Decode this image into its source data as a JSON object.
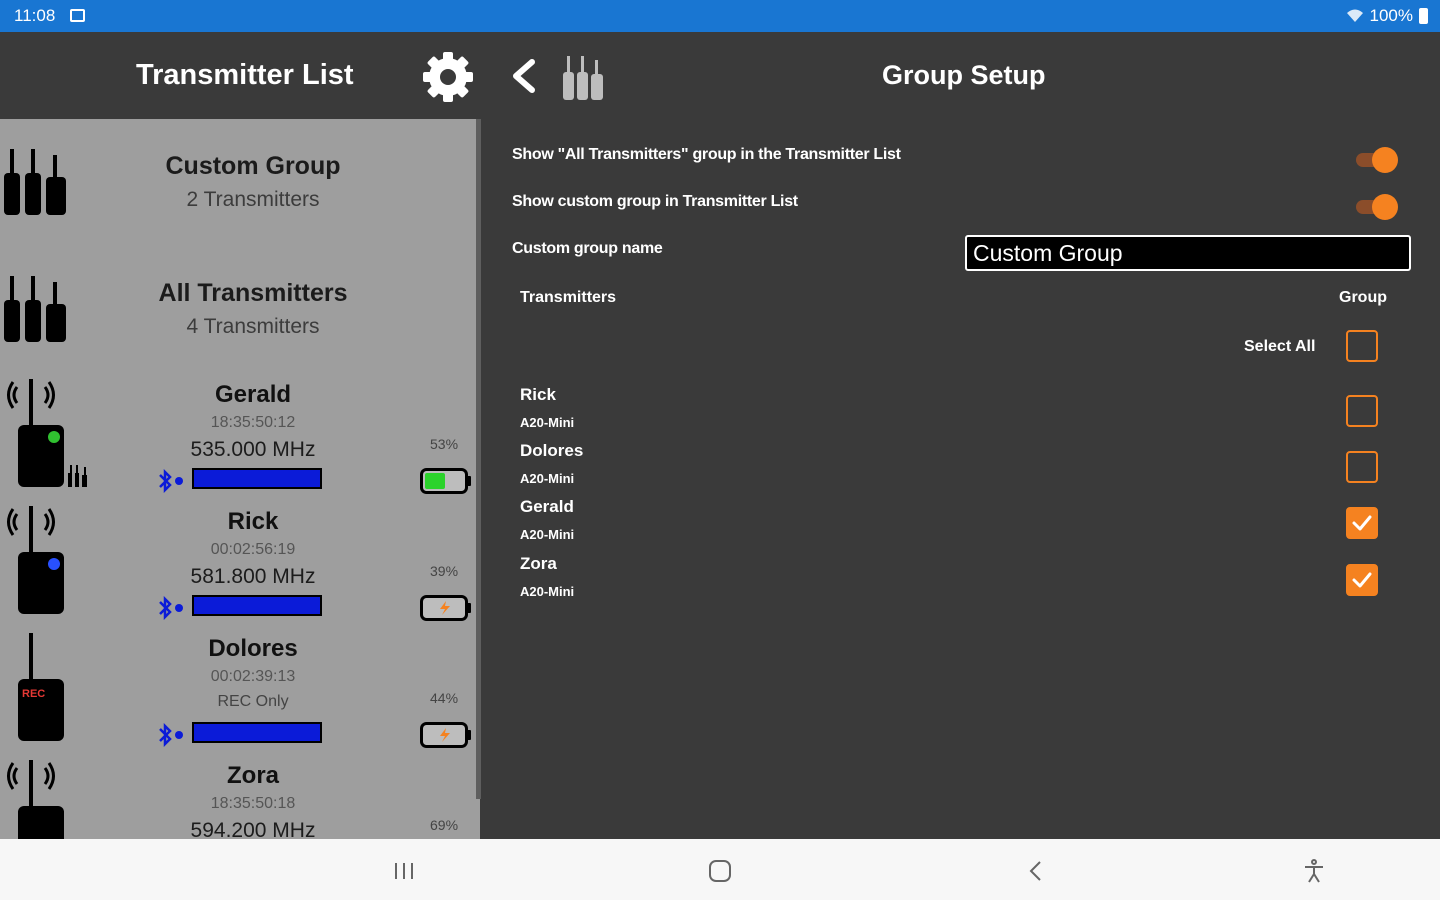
{
  "status_bar": {
    "time": "11:08",
    "battery": "100%"
  },
  "header": {
    "left_title": "Transmitter List",
    "right_title": "Group Setup"
  },
  "transmitter_list": {
    "groups": [
      {
        "name": "Custom Group",
        "count": "2 Transmitters"
      },
      {
        "name": "All Transmitters",
        "count": "4 Transmitters"
      }
    ],
    "transmitters": [
      {
        "name": "Gerald",
        "time": "18:35:50:12",
        "freq": "535.000 MHz",
        "battery_pct": "53%",
        "status_led": "green"
      },
      {
        "name": "Rick",
        "time": "00:02:56:19",
        "freq": "581.800 MHz",
        "battery_pct": "39%",
        "status_led": "blue"
      },
      {
        "name": "Dolores",
        "time": "00:02:39:13",
        "mode": "REC Only",
        "battery_pct": "44%",
        "rec_label": "REC"
      },
      {
        "name": "Zora",
        "time": "18:35:50:18",
        "freq": "594.200 MHz",
        "battery_pct": "69%"
      }
    ]
  },
  "group_setup": {
    "show_all_label": "Show \"All Transmitters\" group in the Transmitter List",
    "show_all_on": true,
    "show_custom_label": "Show custom group in Transmitter List",
    "show_custom_on": true,
    "custom_name_label": "Custom group name",
    "custom_name_value": "Custom Group",
    "col_transmitters": "Transmitters",
    "col_group": "Group",
    "select_all_label": "Select All",
    "items": [
      {
        "name": "Rick",
        "model": "A20-Mini",
        "in_group": false
      },
      {
        "name": "Dolores",
        "model": "A20-Mini",
        "in_group": false
      },
      {
        "name": "Gerald",
        "model": "A20-Mini",
        "in_group": true
      },
      {
        "name": "Zora",
        "model": "A20-Mini",
        "in_group": true
      }
    ]
  },
  "colors": {
    "accent": "#f58220",
    "status_bar": "#1976d2",
    "signal_bar": "#0b1bd8"
  }
}
